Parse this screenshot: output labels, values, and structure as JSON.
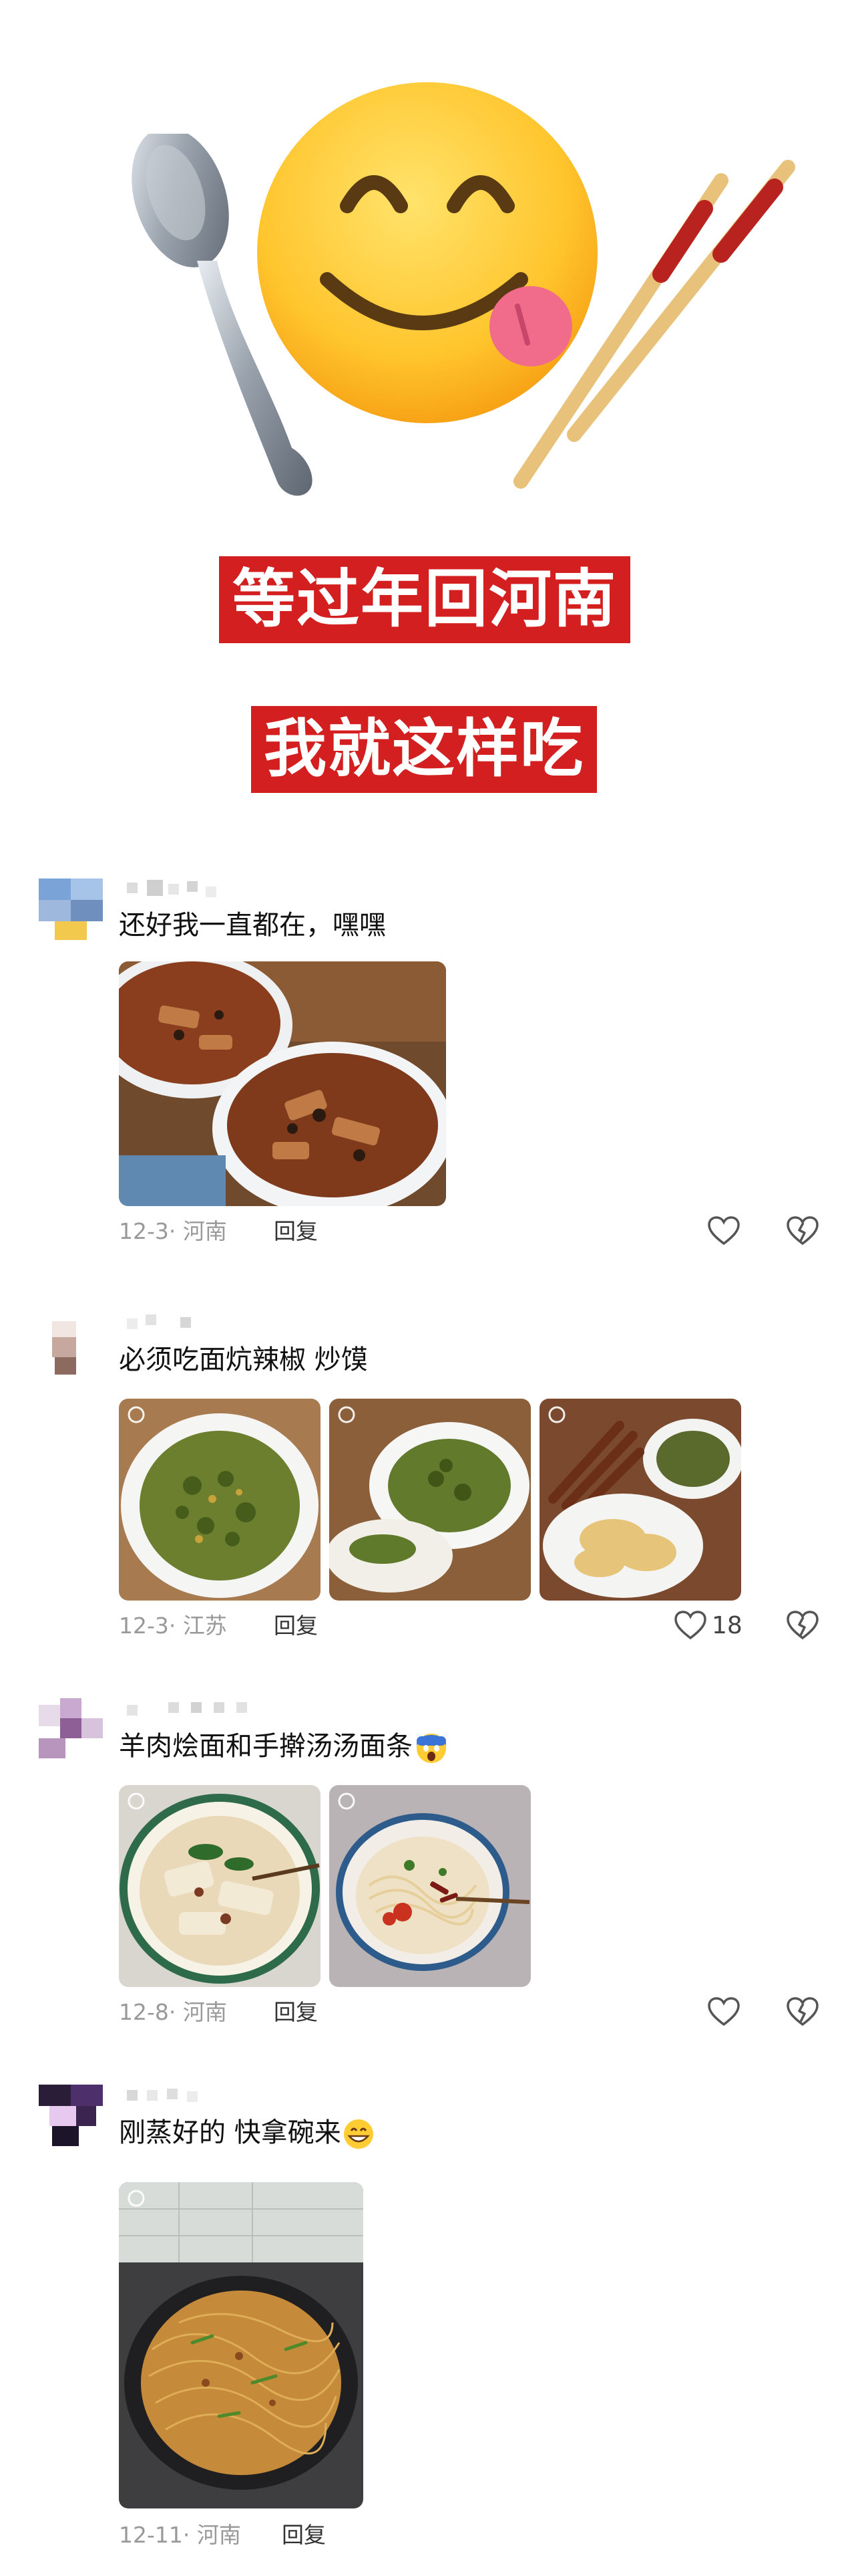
{
  "header": {
    "banner_line1": "等过年回河南",
    "banner_line2": "我就这样吃"
  },
  "comments": [
    {
      "text": "还好我一直都在，嘿嘿",
      "date_location": "12-3· 河南",
      "reply_label": "回复",
      "like_count": ""
    },
    {
      "text": "必须吃面炕辣椒 炒馍",
      "date_location": "12-3· 江苏",
      "reply_label": "回复",
      "like_count": "18"
    },
    {
      "text": "羊肉烩面和手擀汤汤面条",
      "date_location": "12-8· 河南",
      "reply_label": "回复",
      "like_count": ""
    },
    {
      "text": "刚蒸好的  快拿碗来",
      "date_location": "12-11· 河南",
      "reply_label": "回复",
      "like_count": ""
    }
  ],
  "colors": {
    "banner_red": "#d31f1f",
    "meta_gray": "#999999"
  }
}
